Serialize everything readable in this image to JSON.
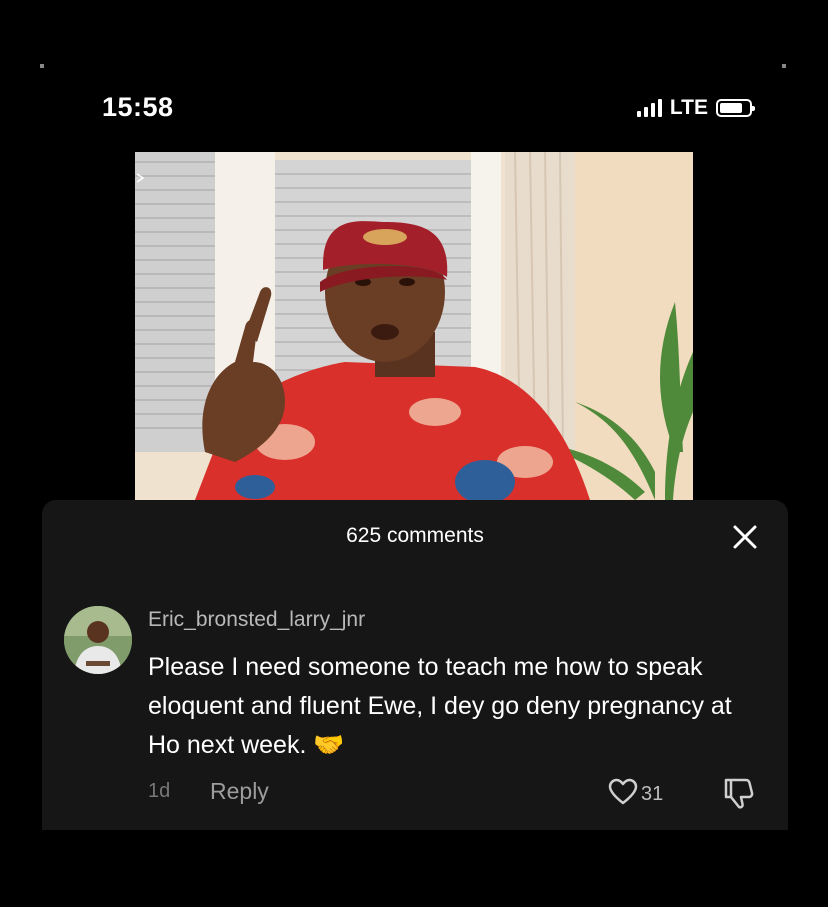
{
  "status_bar": {
    "time": "15:58",
    "network": "LTE",
    "icons": [
      "signal-icon",
      "battery-icon"
    ]
  },
  "video": {
    "description_icons": [
      "video-frame"
    ]
  },
  "comments": {
    "header": "625 comments",
    "close_icon": "close-icon",
    "items": [
      {
        "username": "Eric_bronsted_larry_jnr",
        "text": "Please I need someone to teach me how to speak eloquent and fluent Ewe, I dey go deny pregnancy at Ho next week.",
        "emoji": "🤝",
        "time": "1d",
        "reply_label": "Reply",
        "likes": "31"
      }
    ]
  },
  "colors": {
    "background": "#000000",
    "panel": "#161616",
    "text_primary": "#ffffff",
    "text_secondary": "#b9b9b9",
    "cap_red": "#a3202a",
    "shirt_red": "#d9302c"
  }
}
